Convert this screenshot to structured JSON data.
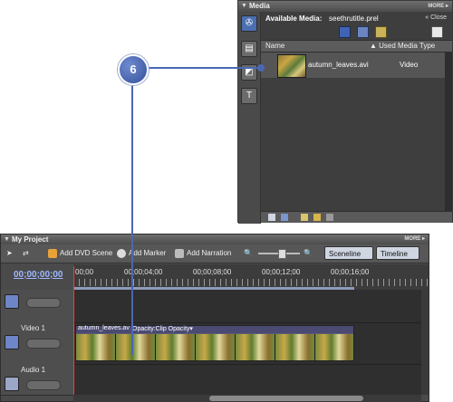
{
  "callout": {
    "number": "6",
    "color": "#4a67b3"
  },
  "media_panel": {
    "title": "Media",
    "more": "MORE ▸",
    "available_label": "Available Media:",
    "project_file": "seethrutitle.prel",
    "close_label": "Close",
    "close_icon": "double-chevron-left-icon",
    "columns": [
      "Name",
      "Used",
      "Media Type"
    ],
    "items": [
      {
        "name": "autumn_leaves.avi",
        "media_type": "Video"
      }
    ],
    "side_icons": [
      "media-icon",
      "video-effects-icon",
      "transitions-icon",
      "titles-icon"
    ],
    "toolbar_icons": [
      "video-filter-icon",
      "audio-filter-icon",
      "image-filter-icon",
      "new-item-icon"
    ]
  },
  "project_panel": {
    "title": "My Project",
    "more": "MORE ▸",
    "toolbar": {
      "add_dvd_scene": "Add DVD Scene",
      "add_marker": "Add Marker",
      "add_narration": "Add Narration",
      "sceneline": "Sceneline",
      "timeline": "Timeline"
    },
    "timecode": "00;00;00;00",
    "ruler_labels": [
      "00;00",
      "00;00;04;00",
      "00;00;08;00",
      "00;00;12;00",
      "00;00;16;00"
    ],
    "tracks": [
      {
        "name": ""
      },
      {
        "name": "Video 1"
      },
      {
        "name": "Audio 1"
      }
    ],
    "clip": {
      "name": "autumn_leaves.av",
      "property": "Opacity:Clip Opacity",
      "dropdown_icon": "▾"
    }
  }
}
